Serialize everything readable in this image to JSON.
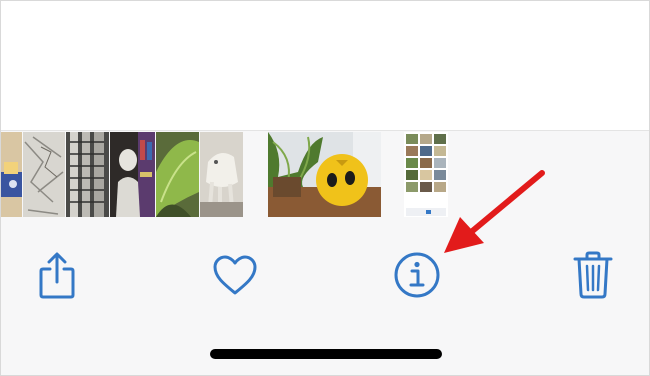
{
  "colors": {
    "accent": "#3478c6",
    "annotation": "#e21b1b",
    "toolbar_background": "#f7f7f8",
    "home_indicator": "#000000"
  },
  "thumbnails": [
    {
      "name": "thumbnail-1"
    },
    {
      "name": "thumbnail-2"
    },
    {
      "name": "thumbnail-3"
    },
    {
      "name": "thumbnail-4"
    },
    {
      "name": "thumbnail-5"
    },
    {
      "name": "thumbnail-6"
    },
    {
      "name": "thumbnail-7"
    },
    {
      "name": "thumbnail-8"
    }
  ],
  "toolbar": {
    "share_icon": "share-icon",
    "favorite_icon": "heart-icon",
    "info_icon": "info-icon",
    "delete_icon": "trash-icon"
  },
  "annotation": {
    "icon": "arrow-pointer-icon"
  }
}
